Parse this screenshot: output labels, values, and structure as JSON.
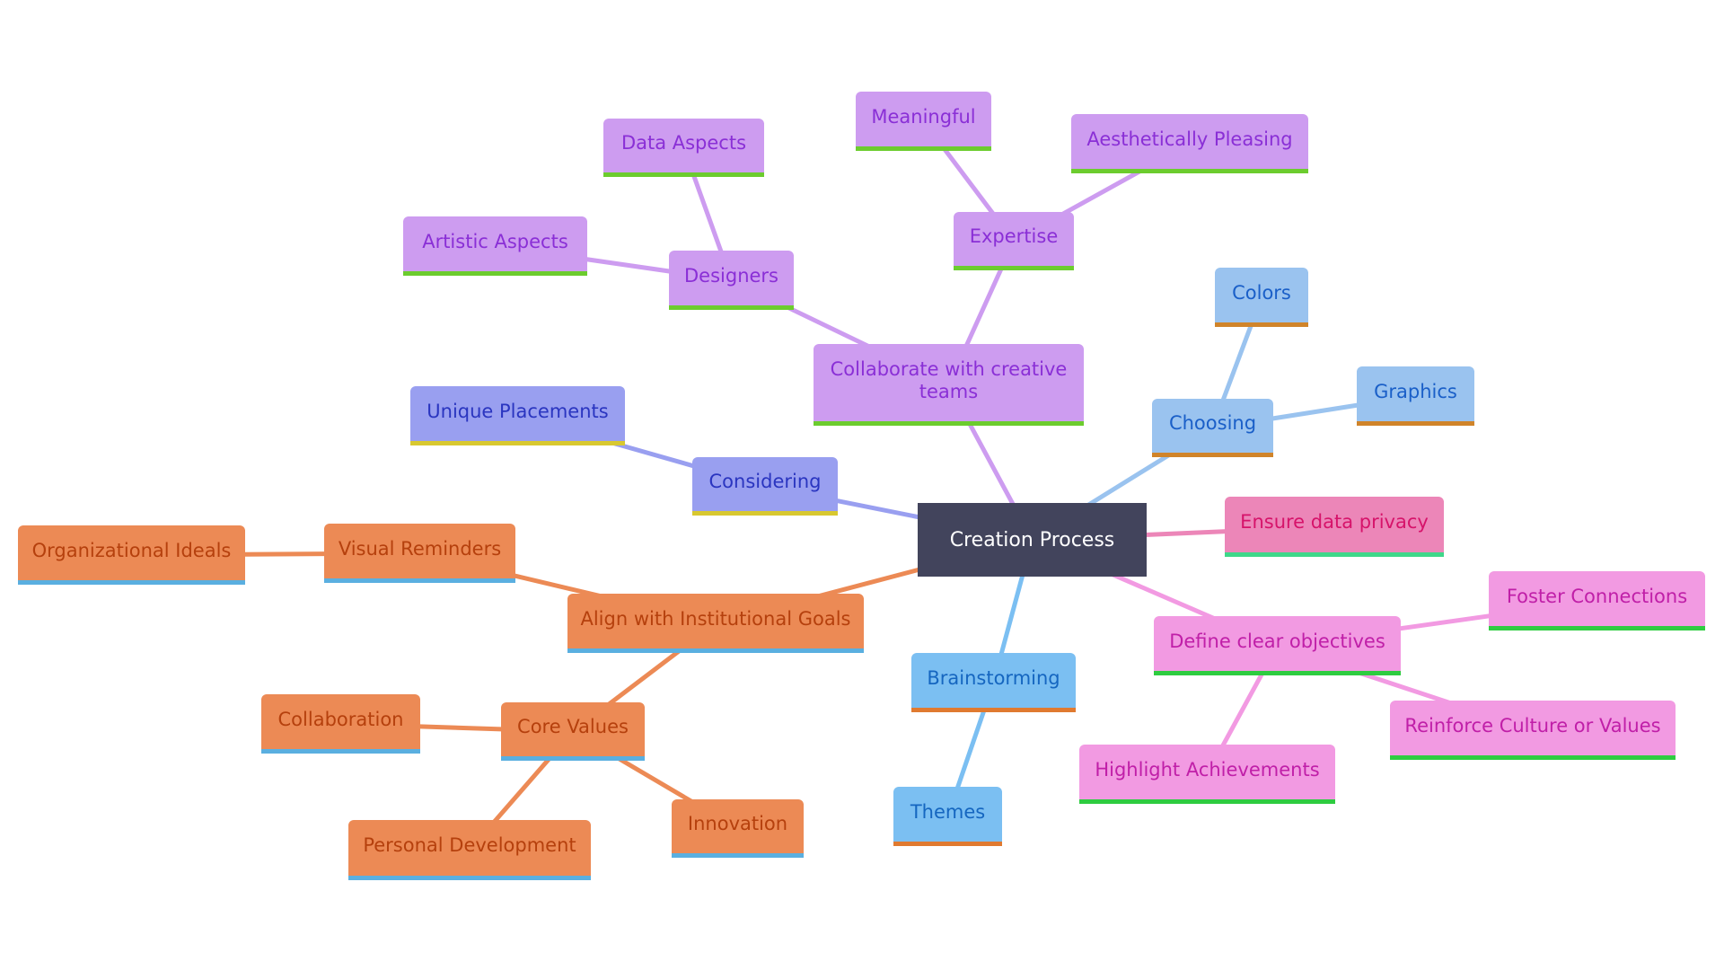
{
  "diagram": {
    "type": "mindmap",
    "root": "Creation Process",
    "branches": [
      {
        "label": "Collaborate with creative teams",
        "theme": "purple",
        "children": [
          {
            "label": "Designers",
            "children": [
              {
                "label": "Data Aspects"
              },
              {
                "label": "Artistic Aspects"
              }
            ]
          },
          {
            "label": "Expertise",
            "children": [
              {
                "label": "Meaningful"
              },
              {
                "label": "Aesthetically Pleasing"
              }
            ]
          }
        ]
      },
      {
        "label": "Choosing",
        "theme": "light-blue",
        "children": [
          {
            "label": "Colors"
          },
          {
            "label": "Graphics"
          }
        ]
      },
      {
        "label": "Ensure data privacy",
        "theme": "rose",
        "children": []
      },
      {
        "label": "Define clear objectives",
        "theme": "pink",
        "children": [
          {
            "label": "Foster Connections"
          },
          {
            "label": "Reinforce Culture or Values"
          },
          {
            "label": "Highlight Achievements"
          }
        ]
      },
      {
        "label": "Brainstorming",
        "theme": "sky",
        "children": [
          {
            "label": "Themes"
          }
        ]
      },
      {
        "label": "Align with Institutional Goals",
        "theme": "orange",
        "children": [
          {
            "label": "Visual Reminders",
            "children": [
              {
                "label": "Organizational Ideals"
              }
            ]
          },
          {
            "label": "Core Values",
            "children": [
              {
                "label": "Collaboration"
              },
              {
                "label": "Innovation"
              },
              {
                "label": "Personal Development"
              }
            ]
          }
        ]
      },
      {
        "label": "Considering",
        "theme": "indigo",
        "children": [
          {
            "label": "Unique Placements"
          }
        ]
      }
    ]
  },
  "labels": {
    "root": "Creation Process",
    "collaborate": "Collaborate with creative teams",
    "designers": "Designers",
    "data_aspects": "Data Aspects",
    "artistic_aspects": "Artistic Aspects",
    "expertise": "Expertise",
    "meaningful": "Meaningful",
    "aesthetically_pleasing": "Aesthetically Pleasing",
    "choosing": "Choosing",
    "colors": "Colors",
    "graphics": "Graphics",
    "ensure_privacy": "Ensure data privacy",
    "define_objectives": "Define clear objectives",
    "foster_connections": "Foster Connections",
    "reinforce_culture": "Reinforce Culture or Values",
    "highlight_achievements": "Highlight Achievements",
    "brainstorming": "Brainstorming",
    "themes": "Themes",
    "align_goals": "Align with Institutional Goals",
    "visual_reminders": "Visual Reminders",
    "organizational_ideals": "Organizational Ideals",
    "core_values": "Core Values",
    "collaboration": "Collaboration",
    "innovation": "Innovation",
    "personal_development": "Personal Development",
    "considering": "Considering",
    "unique_placements": "Unique Placements"
  },
  "colors": {
    "root": "#42445c",
    "purple": "#cd9cf0",
    "indigo": "#999ff0",
    "orange": "#ec8a55",
    "light_blue": "#9ac3ef",
    "sky": "#7bbff2",
    "pink": "#f29ae2",
    "rose": "#ec86b8"
  }
}
